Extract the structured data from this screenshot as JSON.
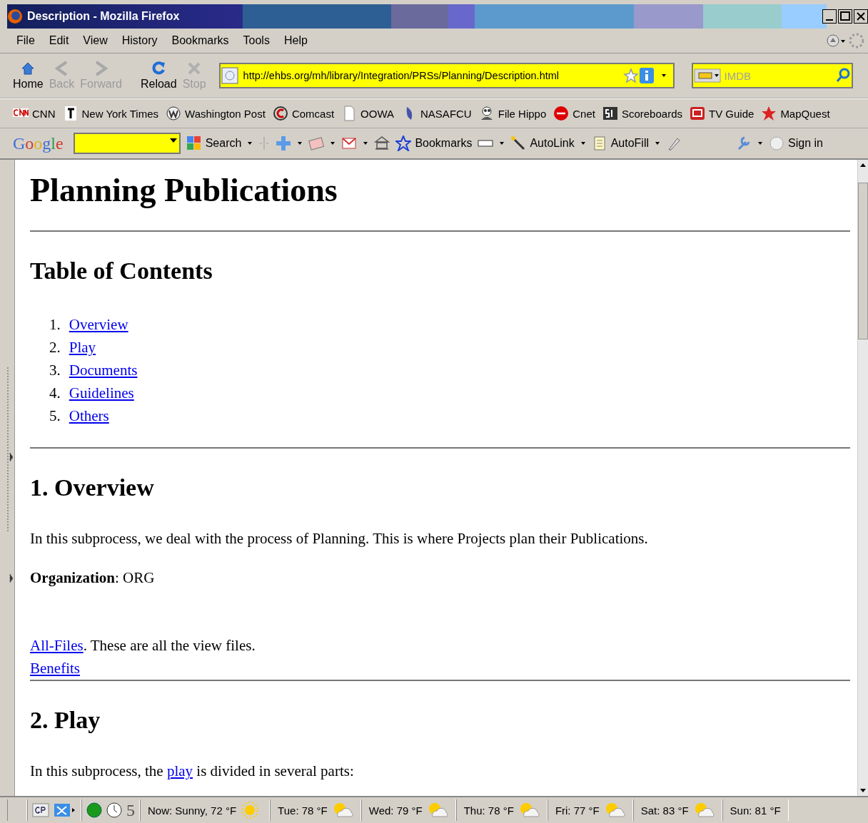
{
  "window": {
    "title": "Description - Mozilla Firefox"
  },
  "menu": [
    "File",
    "Edit",
    "View",
    "History",
    "Bookmarks",
    "Tools",
    "Help"
  ],
  "nav_buttons": [
    {
      "label": "Home",
      "kind": "home",
      "disabled": false
    },
    {
      "label": "Back",
      "kind": "back",
      "disabled": true
    },
    {
      "label": "Forward",
      "kind": "forward",
      "disabled": true
    },
    {
      "label": "Reload",
      "kind": "reload",
      "disabled": false
    },
    {
      "label": "Stop",
      "kind": "stop",
      "disabled": true
    }
  ],
  "address": {
    "value": "http://ehbs.org/mh/library/Integration/PRSs/Planning/Description.html"
  },
  "search": {
    "placeholder": "IMDB"
  },
  "bookmarks": [
    "CNN",
    "New York Times",
    "Washington Post",
    "Comcast",
    "OOWA",
    "NASAFCU",
    "File Hippo",
    "Cnet",
    "Scoreboards",
    "TV Guide",
    "MapQuest"
  ],
  "google_toolbar": {
    "logo": "Google",
    "items": [
      {
        "label": "Search",
        "kind": "search"
      },
      {
        "label": "Bookmarks",
        "kind": "bookmarks"
      },
      {
        "label": "AutoLink",
        "kind": "autolink"
      },
      {
        "label": "AutoFill",
        "kind": "autofill"
      },
      {
        "label": "Sign in",
        "kind": "signin"
      }
    ]
  },
  "page": {
    "title": "Planning Publications",
    "toc_heading": "Table of Contents",
    "toc": [
      {
        "number": "1.",
        "label": "Overview"
      },
      {
        "number": "2.",
        "label": "Play"
      },
      {
        "number": "3.",
        "label": "Documents"
      },
      {
        "number": "4.",
        "label": "Guidelines"
      },
      {
        "number": "5.",
        "label": "Others"
      }
    ],
    "sections": [
      {
        "heading": "1. Overview",
        "blocks": [
          {
            "kind": "text",
            "parts": [
              {
                "text": "In this subprocess, we deal with the process of Planning. This is where Projects plan their Publications."
              }
            ]
          },
          {
            "kind": "text",
            "parts": [
              {
                "text": "**Organization**: ORG"
              }
            ]
          },
          {
            "kind": "spacer"
          },
          {
            "kind": "line",
            "parts": [
              {
                "link": "All-Files"
              },
              {
                "text": ". These are all the view files."
              }
            ]
          },
          {
            "kind": "line",
            "parts": [
              {
                "link": "Benefits"
              }
            ]
          }
        ]
      },
      {
        "heading": "2. Play",
        "blocks": [
          {
            "kind": "text",
            "parts": [
              {
                "text": "In this subprocess, the "
              },
              {
                "inline_link": "play"
              },
              {
                "text": " is divided in several parts:"
              }
            ]
          }
        ]
      }
    ]
  },
  "status": {
    "counter": "5",
    "weather": [
      {
        "label": "Now: Sunny, 72 °F",
        "kind": "sunny"
      },
      {
        "label": "Tue: 78 °F",
        "kind": "partly_cloudy"
      },
      {
        "label": "Wed: 79 °F",
        "kind": "partly_cloudy"
      },
      {
        "label": "Thu: 78 °F",
        "kind": "partly_cloudy"
      },
      {
        "label": "Fri: 77 °F",
        "kind": "partly_cloudy"
      },
      {
        "label": "Sat: 83 °F",
        "kind": "partly_cloudy"
      },
      {
        "label": "Sun: 81 °F",
        "kind": "none"
      }
    ]
  }
}
